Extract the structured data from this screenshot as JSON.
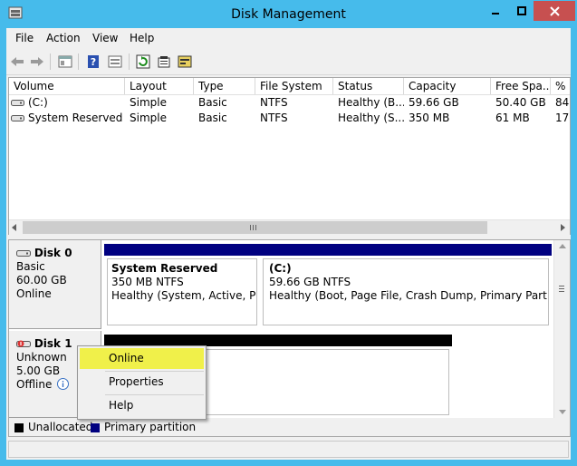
{
  "window": {
    "title": "Disk Management"
  },
  "menubar": {
    "items": [
      "File",
      "Action",
      "View",
      "Help"
    ]
  },
  "toolbar": {
    "icons": [
      "back-icon",
      "forward-icon",
      "console-tree-icon",
      "help-icon",
      "properties-view-icon",
      "refresh-icon",
      "properties-icon",
      "rescan-icon"
    ]
  },
  "volumes": {
    "columns": [
      "Volume",
      "Layout",
      "Type",
      "File System",
      "Status",
      "Capacity",
      "Free Spa...",
      "% F"
    ],
    "rows": [
      {
        "volume": "(C:)",
        "layout": "Simple",
        "type": "Basic",
        "fs": "NTFS",
        "status": "Healthy (B...",
        "capacity": "59.66 GB",
        "free": "50.40 GB",
        "pct": "84"
      },
      {
        "volume": "System Reserved",
        "layout": "Simple",
        "type": "Basic",
        "fs": "NTFS",
        "status": "Healthy (S...",
        "capacity": "350 MB",
        "free": "61 MB",
        "pct": "17"
      }
    ]
  },
  "disks": [
    {
      "name": "Disk 0",
      "type": "Basic",
      "size": "60.00 GB",
      "state": "Online",
      "partitions": [
        {
          "name": "System Reserved",
          "size": "350 MB NTFS",
          "status": "Healthy (System, Active, Prim"
        },
        {
          "name": "(C:)",
          "size": "59.66 GB NTFS",
          "status": "Healthy (Boot, Page File, Crash Dump, Primary Partition)"
        }
      ]
    },
    {
      "name": "Disk 1",
      "type": "Unknown",
      "size": "5.00 GB",
      "state": "Offline"
    }
  ],
  "legend": [
    {
      "label": "Unallocated",
      "color": "#000000"
    },
    {
      "label": "Primary partition",
      "color": "#000080"
    }
  ],
  "context_menu": {
    "items": [
      "Online",
      "Properties",
      "Help"
    ],
    "highlighted": "Online"
  },
  "colors": {
    "titlebar": "#46bbeb",
    "close_button": "#c75050",
    "primary_partition": "#000080",
    "unallocated": "#000000",
    "menu_highlight": "#f0f04a"
  }
}
